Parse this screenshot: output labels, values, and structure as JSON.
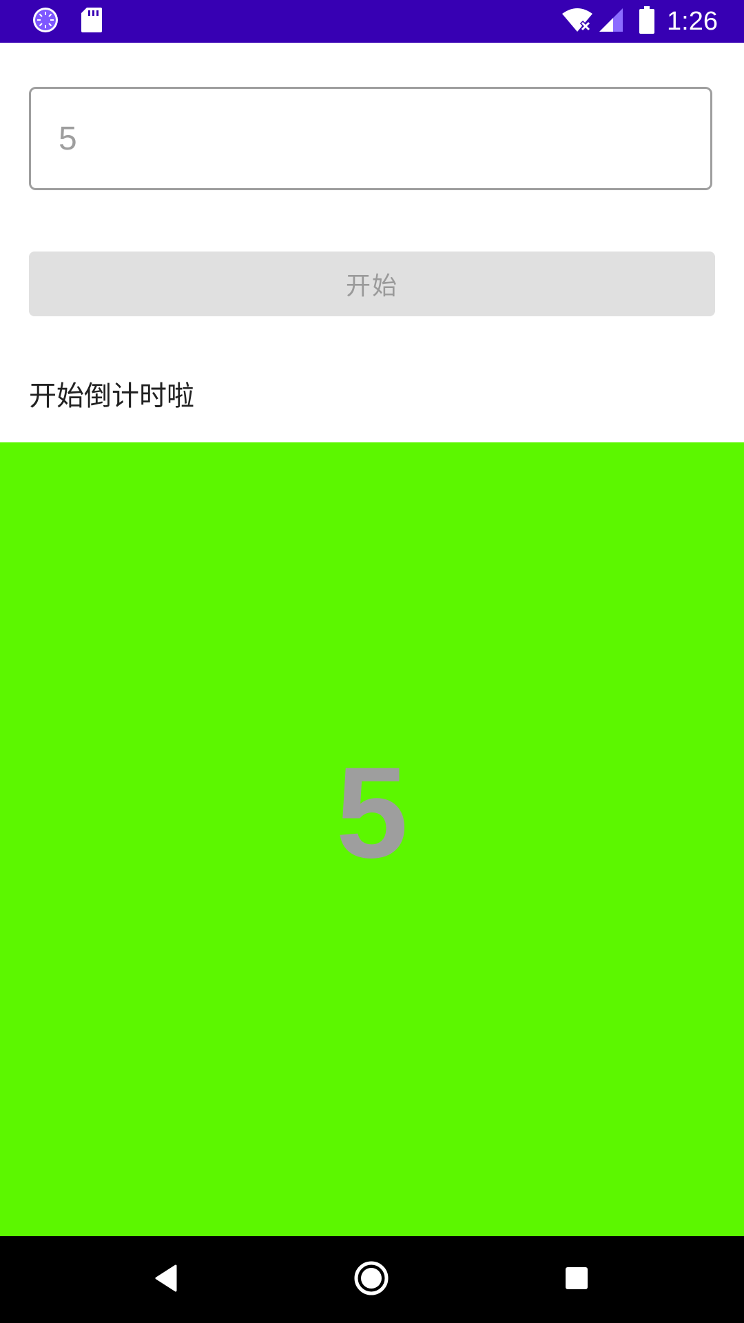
{
  "status_bar": {
    "time": "1:26",
    "icons": [
      "sync-icon",
      "sd-card-icon",
      "wifi-off-icon",
      "signal-icon",
      "battery-icon"
    ],
    "background_color": "#3700b3"
  },
  "input": {
    "value": "5"
  },
  "start_button": {
    "label": "开始"
  },
  "status_message": "开始倒计时啦",
  "countdown": {
    "value": "5",
    "panel_color": "#5cf700"
  },
  "nav_bar": {
    "icons": [
      "back-icon",
      "home-icon",
      "recents-icon"
    ]
  }
}
